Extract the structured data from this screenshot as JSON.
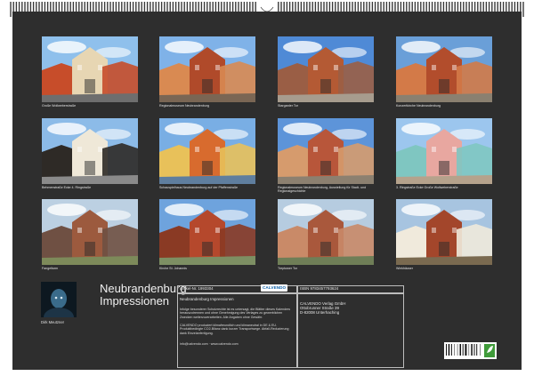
{
  "photos": [
    {
      "caption": "Große Wollweberstraße",
      "two_line": false,
      "scene": "street"
    },
    {
      "caption": "Regionalmuseum Neubrandenburg",
      "two_line": false,
      "scene": "gate"
    },
    {
      "caption": "Stargarder Tor",
      "two_line": false,
      "scene": "tower"
    },
    {
      "caption": "Konzertkirche Neubrandenburg",
      "two_line": false,
      "scene": "church"
    },
    {
      "caption": "Behmenstraße Ecke 4. Ringstraße",
      "two_line": false,
      "scene": "halftimber"
    },
    {
      "caption": "Schauspielhaus Neubrandenburg auf der Pfaffenstraße",
      "two_line": false,
      "scene": "colorful"
    },
    {
      "caption": "Regionalmuseum Neubrandenburg, Ausstellung für Stadt- und Regionalgeschichte",
      "two_line": true,
      "scene": "museum"
    },
    {
      "caption": "3. Ringstraße Ecke Große Wollweberstraße",
      "two_line": false,
      "scene": "pastel"
    },
    {
      "caption": "Fangelturm",
      "two_line": false,
      "scene": "roundtower"
    },
    {
      "caption": "Kirche St. Johannis",
      "two_line": false,
      "scene": "redchurch"
    },
    {
      "caption": "Treptower Tor",
      "two_line": false,
      "scene": "wall"
    },
    {
      "caption": "Wiekhäuser",
      "two_line": false,
      "scene": "wiekhaus"
    }
  ],
  "author": {
    "name": "Dirk Meutzner"
  },
  "title": {
    "line1": "Neubrandenburg",
    "line2": "Impressionen"
  },
  "product": {
    "article": "Artikel-Nr. 1993304",
    "isbn": "ISBN 9783457793624",
    "name": "Neubrandenburg Impressionen",
    "logo": "CALVENDO",
    "description": "Infolge besonderer Schutzrechte ist es untersagt, die Blätter dieses Kalenders herauszutrennen und ohne Genehmigung des Verlages zu gewerblichen Zwecken weiterzuverarbeiten. Alle Angaben ohne Gewähr.",
    "eco_note": "CALVENDO produziert klimafreundlich und klimaneutral in DE & EU. Produktbedingte CO2-Bilanz dank kurzer Transportwege. Abfall-Reduzierung dank Einzelanfertigung.",
    "contact": "info@calvendo.com · www.calvendo.com",
    "publisher_lines": [
      "CALVENDO Verlag GmbH",
      "Ottobrunner Straße 39",
      "D-82008 Unterhaching"
    ]
  }
}
